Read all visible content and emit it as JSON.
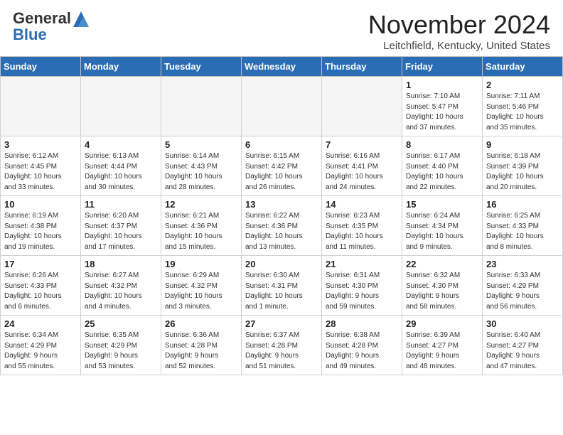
{
  "header": {
    "logo": {
      "line1": "General",
      "line2": "Blue"
    },
    "title": "November 2024",
    "location": "Leitchfield, Kentucky, United States"
  },
  "calendar": {
    "days_of_week": [
      "Sunday",
      "Monday",
      "Tuesday",
      "Wednesday",
      "Thursday",
      "Friday",
      "Saturday"
    ],
    "weeks": [
      [
        {
          "day": "",
          "empty": true
        },
        {
          "day": "",
          "empty": true
        },
        {
          "day": "",
          "empty": true
        },
        {
          "day": "",
          "empty": true
        },
        {
          "day": "",
          "empty": true
        },
        {
          "day": "1",
          "info": "Sunrise: 7:10 AM\nSunset: 5:47 PM\nDaylight: 10 hours\nand 37 minutes."
        },
        {
          "day": "2",
          "info": "Sunrise: 7:11 AM\nSunset: 5:46 PM\nDaylight: 10 hours\nand 35 minutes."
        }
      ],
      [
        {
          "day": "3",
          "info": "Sunrise: 6:12 AM\nSunset: 4:45 PM\nDaylight: 10 hours\nand 33 minutes."
        },
        {
          "day": "4",
          "info": "Sunrise: 6:13 AM\nSunset: 4:44 PM\nDaylight: 10 hours\nand 30 minutes."
        },
        {
          "day": "5",
          "info": "Sunrise: 6:14 AM\nSunset: 4:43 PM\nDaylight: 10 hours\nand 28 minutes."
        },
        {
          "day": "6",
          "info": "Sunrise: 6:15 AM\nSunset: 4:42 PM\nDaylight: 10 hours\nand 26 minutes."
        },
        {
          "day": "7",
          "info": "Sunrise: 6:16 AM\nSunset: 4:41 PM\nDaylight: 10 hours\nand 24 minutes."
        },
        {
          "day": "8",
          "info": "Sunrise: 6:17 AM\nSunset: 4:40 PM\nDaylight: 10 hours\nand 22 minutes."
        },
        {
          "day": "9",
          "info": "Sunrise: 6:18 AM\nSunset: 4:39 PM\nDaylight: 10 hours\nand 20 minutes."
        }
      ],
      [
        {
          "day": "10",
          "info": "Sunrise: 6:19 AM\nSunset: 4:38 PM\nDaylight: 10 hours\nand 19 minutes."
        },
        {
          "day": "11",
          "info": "Sunrise: 6:20 AM\nSunset: 4:37 PM\nDaylight: 10 hours\nand 17 minutes."
        },
        {
          "day": "12",
          "info": "Sunrise: 6:21 AM\nSunset: 4:36 PM\nDaylight: 10 hours\nand 15 minutes."
        },
        {
          "day": "13",
          "info": "Sunrise: 6:22 AM\nSunset: 4:36 PM\nDaylight: 10 hours\nand 13 minutes."
        },
        {
          "day": "14",
          "info": "Sunrise: 6:23 AM\nSunset: 4:35 PM\nDaylight: 10 hours\nand 11 minutes."
        },
        {
          "day": "15",
          "info": "Sunrise: 6:24 AM\nSunset: 4:34 PM\nDaylight: 10 hours\nand 9 minutes."
        },
        {
          "day": "16",
          "info": "Sunrise: 6:25 AM\nSunset: 4:33 PM\nDaylight: 10 hours\nand 8 minutes."
        }
      ],
      [
        {
          "day": "17",
          "info": "Sunrise: 6:26 AM\nSunset: 4:33 PM\nDaylight: 10 hours\nand 6 minutes."
        },
        {
          "day": "18",
          "info": "Sunrise: 6:27 AM\nSunset: 4:32 PM\nDaylight: 10 hours\nand 4 minutes."
        },
        {
          "day": "19",
          "info": "Sunrise: 6:29 AM\nSunset: 4:32 PM\nDaylight: 10 hours\nand 3 minutes."
        },
        {
          "day": "20",
          "info": "Sunrise: 6:30 AM\nSunset: 4:31 PM\nDaylight: 10 hours\nand 1 minute."
        },
        {
          "day": "21",
          "info": "Sunrise: 6:31 AM\nSunset: 4:30 PM\nDaylight: 9 hours\nand 59 minutes."
        },
        {
          "day": "22",
          "info": "Sunrise: 6:32 AM\nSunset: 4:30 PM\nDaylight: 9 hours\nand 58 minutes."
        },
        {
          "day": "23",
          "info": "Sunrise: 6:33 AM\nSunset: 4:29 PM\nDaylight: 9 hours\nand 56 minutes."
        }
      ],
      [
        {
          "day": "24",
          "info": "Sunrise: 6:34 AM\nSunset: 4:29 PM\nDaylight: 9 hours\nand 55 minutes."
        },
        {
          "day": "25",
          "info": "Sunrise: 6:35 AM\nSunset: 4:29 PM\nDaylight: 9 hours\nand 53 minutes."
        },
        {
          "day": "26",
          "info": "Sunrise: 6:36 AM\nSunset: 4:28 PM\nDaylight: 9 hours\nand 52 minutes."
        },
        {
          "day": "27",
          "info": "Sunrise: 6:37 AM\nSunset: 4:28 PM\nDaylight: 9 hours\nand 51 minutes."
        },
        {
          "day": "28",
          "info": "Sunrise: 6:38 AM\nSunset: 4:28 PM\nDaylight: 9 hours\nand 49 minutes."
        },
        {
          "day": "29",
          "info": "Sunrise: 6:39 AM\nSunset: 4:27 PM\nDaylight: 9 hours\nand 48 minutes."
        },
        {
          "day": "30",
          "info": "Sunrise: 6:40 AM\nSunset: 4:27 PM\nDaylight: 9 hours\nand 47 minutes."
        }
      ]
    ]
  }
}
